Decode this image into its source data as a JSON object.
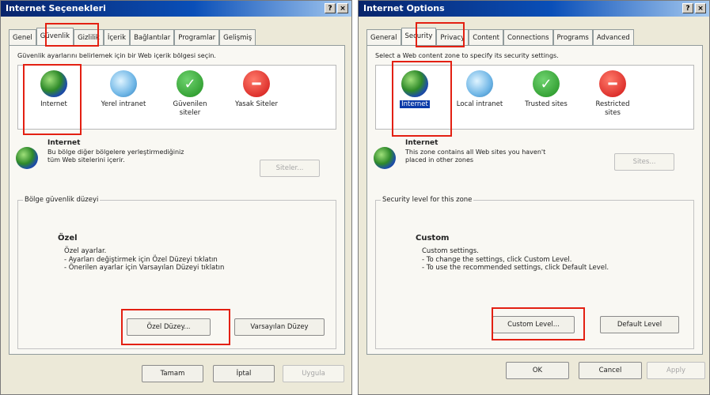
{
  "left": {
    "title": "Internet Seçenekleri",
    "tabs": [
      "Genel",
      "Güvenlik",
      "Gizlilik",
      "İçerik",
      "Bağlantılar",
      "Programlar",
      "Gelişmiş"
    ],
    "prompt": "Güvenlik ayarlarını belirlemek için bir Web içerik bölgesi seçin.",
    "zones": [
      {
        "label": "Internet",
        "icon": "globe-icon"
      },
      {
        "label": "Yerel intranet",
        "icon": "intranet-icon"
      },
      {
        "label": "Güvenilen siteler",
        "icon": "checkmark-icon"
      },
      {
        "label": "Yasak Siteler",
        "icon": "no-entry-icon"
      }
    ],
    "zone_name": "Internet",
    "zone_desc": "Bu bölge diğer bölgelere yerleştirmediğiniz tüm Web sitelerini içerir.",
    "sites_button": "Siteler...",
    "level_group": "Bölge güvenlik düzeyi",
    "level_title": "Özel",
    "level_lines": [
      "Özel ayarlar.",
      "- Ayarları değiştirmek için Özel Düzeyi tıklatın",
      "- Önerilen ayarlar için Varsayılan Düzeyi tıklatın"
    ],
    "custom_button": "Özel Düzey...",
    "default_button": "Varsayılan Düzey",
    "ok": "Tamam",
    "cancel": "İptal",
    "apply": "Uygula"
  },
  "right": {
    "title": "Internet Options",
    "tabs": [
      "General",
      "Security",
      "Privacy",
      "Content",
      "Connections",
      "Programs",
      "Advanced"
    ],
    "prompt": "Select a Web content zone to specify its security settings.",
    "zones": [
      {
        "label": "Internet",
        "icon": "globe-icon"
      },
      {
        "label": "Local intranet",
        "icon": "intranet-icon"
      },
      {
        "label": "Trusted sites",
        "icon": "checkmark-icon"
      },
      {
        "label": "Restricted sites",
        "icon": "no-entry-icon"
      }
    ],
    "zone_name": "Internet",
    "zone_desc": "This zone contains all Web sites you haven't placed in other zones",
    "sites_button": "Sites...",
    "level_group": "Security level for this zone",
    "level_title": "Custom",
    "level_lines": [
      "Custom settings.",
      "- To change the settings, click Custom Level.",
      "- To use the recommended settings, click Default Level."
    ],
    "custom_button": "Custom Level...",
    "default_button": "Default Level",
    "ok": "OK",
    "cancel": "Cancel",
    "apply": "Apply"
  },
  "title_buttons": [
    "?",
    "×"
  ],
  "highlight_color": "#e32012"
}
